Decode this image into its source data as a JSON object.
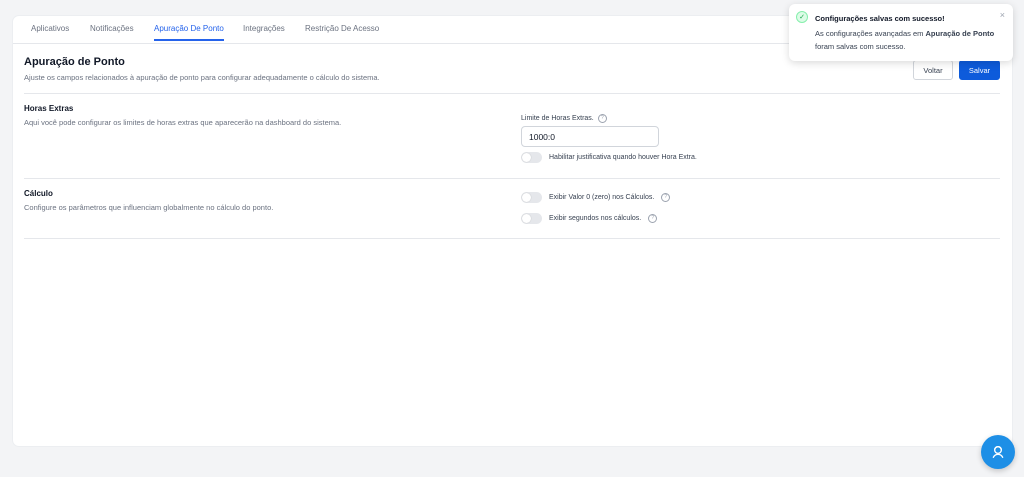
{
  "tabs": [
    {
      "label": "Aplicativos",
      "active": false
    },
    {
      "label": "Notificações",
      "active": false
    },
    {
      "label": "Apuração De Ponto",
      "active": true
    },
    {
      "label": "Integrações",
      "active": false
    },
    {
      "label": "Restrição De Acesso",
      "active": false
    }
  ],
  "header": {
    "title": "Apuração de Ponto",
    "subtitle": "Ajuste os campos relacionados à apuração de ponto para configurar adequadamente o cálculo do sistema.",
    "back_label": "Voltar",
    "save_label": "Salvar"
  },
  "horas_extras": {
    "title": "Horas Extras",
    "description": "Aqui você pode configurar os limites de horas extras que aparecerão na dashboard do sistema.",
    "limit_label": "Limite de Horas Extras.",
    "limit_value": "1000:0",
    "justify_toggle_label": "Habilitar justificativa quando houver Hora Extra.",
    "justify_toggle_on": false
  },
  "calculo": {
    "title": "Cálculo",
    "description": "Configure os parâmetros que influenciam globalmente no cálculo do ponto.",
    "zero_toggle_label": "Exibir Valor 0 (zero) nos Cálculos.",
    "zero_toggle_on": false,
    "seconds_toggle_label": "Exibir segundos nos cálculos.",
    "seconds_toggle_on": false
  },
  "toast": {
    "title": "Configurações salvas com sucesso!",
    "body_prefix": "As configurações avançadas em ",
    "body_bold": "Apuração de Ponto",
    "body_suffix": " foram salvas com sucesso.",
    "close_symbol": "×"
  },
  "colors": {
    "accent": "#2563eb",
    "primary_button": "#0d5bdb",
    "success": "#16a34a",
    "fab": "#1e8fe6"
  },
  "icons": {
    "help": "question-circle-icon",
    "success": "check-circle-icon",
    "close": "close-icon",
    "support": "headset-icon"
  }
}
